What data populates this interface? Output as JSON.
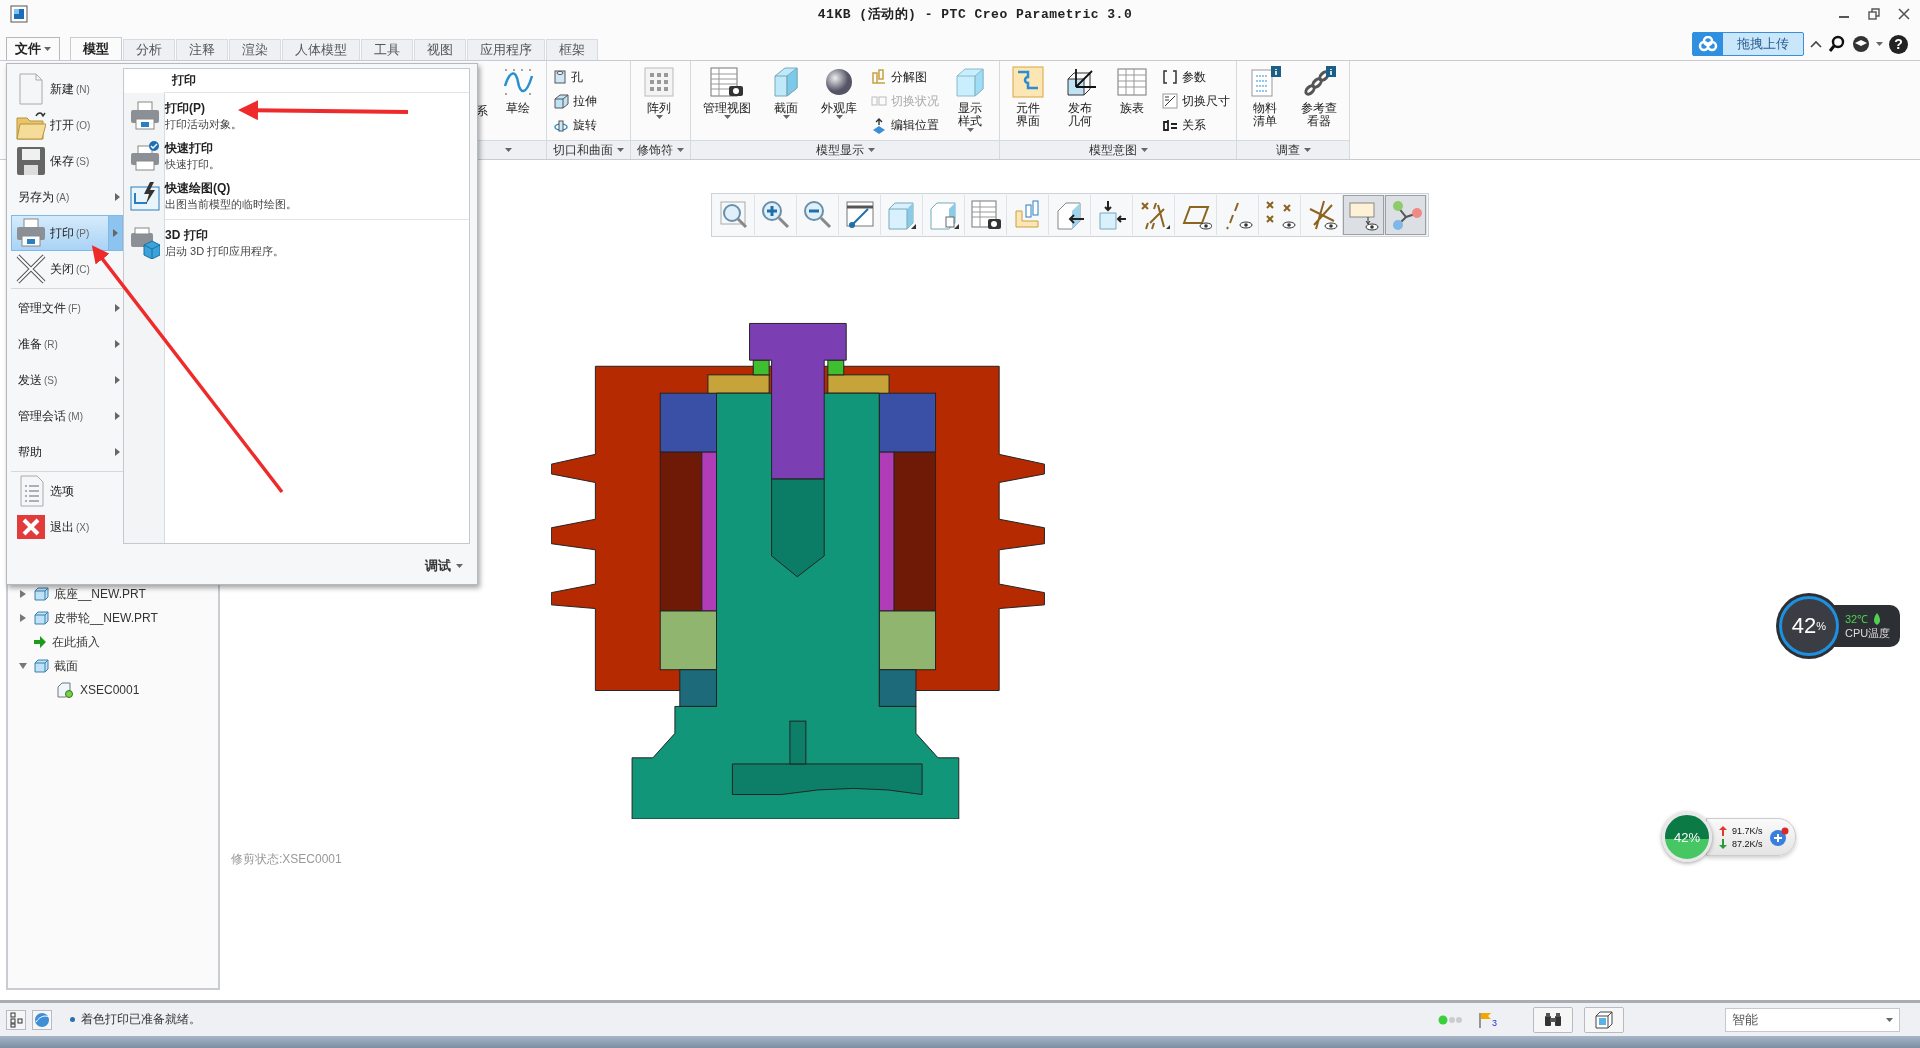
{
  "window": {
    "title": "41KB (活动的) - PTC Creo Parametric 3.0"
  },
  "upload_button": {
    "label": "拖拽上传"
  },
  "help_button": "?",
  "tabs": [
    {
      "label": "文件",
      "kind": "menu",
      "open": true
    },
    {
      "label": "模型",
      "kind": "tab",
      "selected": true
    },
    {
      "label": "分析",
      "kind": "tab",
      "selected": false
    },
    {
      "label": "注释",
      "kind": "tab",
      "selected": false
    },
    {
      "label": "渲染",
      "kind": "tab",
      "selected": false
    },
    {
      "label": "人体模型",
      "kind": "tab",
      "selected": false
    },
    {
      "label": "工具",
      "kind": "tab",
      "selected": false
    },
    {
      "label": "视图",
      "kind": "tab",
      "selected": false
    },
    {
      "label": "应用程序",
      "kind": "tab",
      "selected": false
    },
    {
      "label": "框架",
      "kind": "tab",
      "selected": false
    }
  ],
  "ribbon_groups": [
    {
      "items": [
        {
          "kind": "partial",
          "label": "系"
        },
        {
          "kind": "large",
          "label": "草绘",
          "disabled": false
        }
      ]
    },
    {
      "label": "切口和曲面",
      "items": [
        {
          "kind": "small",
          "label": "孔",
          "disabled": false
        },
        {
          "kind": "small",
          "label": "拉伸",
          "disabled": false
        },
        {
          "kind": "small",
          "label": "旋转",
          "disabled": false
        }
      ]
    },
    {
      "label": "修饰符",
      "items": [
        {
          "kind": "large",
          "label": "阵列",
          "dropdown": true,
          "disabled": false
        }
      ]
    },
    {
      "label": "模型显示",
      "items": [
        {
          "kind": "large",
          "label": "管理视图",
          "dropdown": true,
          "disabled": false
        },
        {
          "kind": "large",
          "label": "截面",
          "dropdown": true,
          "disabled": false
        },
        {
          "kind": "large",
          "label": "外观库",
          "dropdown": true,
          "disabled": false
        },
        {
          "kind": "small",
          "label": "分解图",
          "disabled": false
        },
        {
          "kind": "small",
          "label": "切换状况",
          "disabled": true
        },
        {
          "kind": "small",
          "label": "编辑位置",
          "disabled": false
        },
        {
          "kind": "tall",
          "label": "显示样式",
          "dropdown": true,
          "disabled": false
        }
      ]
    },
    {
      "label": "模型意图",
      "items": [
        {
          "kind": "tall",
          "label": "元件界面",
          "disabled": false
        },
        {
          "kind": "tall",
          "label": "发布几何",
          "disabled": false
        },
        {
          "kind": "large",
          "label": "族表",
          "disabled": false
        },
        {
          "kind": "small",
          "label": "参数",
          "disabled": false
        },
        {
          "kind": "small",
          "label": "切换尺寸",
          "disabled": false
        },
        {
          "kind": "small",
          "label": "关系",
          "disabled": false
        }
      ]
    },
    {
      "label": "调查",
      "items": [
        {
          "kind": "tall",
          "label": "物料清单",
          "disabled": false
        },
        {
          "kind": "tall",
          "label": "参考查看器",
          "disabled": false
        }
      ]
    }
  ],
  "file_menu": {
    "sections": [
      [
        {
          "kind": "new",
          "label": "新建",
          "key": "(N)",
          "submenu": false,
          "selected": false
        },
        {
          "kind": "open",
          "label": "打开",
          "key": "(O)",
          "submenu": false,
          "selected": false
        },
        {
          "kind": "save",
          "label": "保存",
          "key": "(S)",
          "submenu": false,
          "selected": false
        },
        {
          "kind": "saveas",
          "label": "另存为",
          "key": "(A)",
          "submenu": true,
          "selected": false
        },
        {
          "kind": "print",
          "label": "打印",
          "key": "(P)",
          "submenu": true,
          "selected": true
        },
        {
          "kind": "close",
          "label": "关闭",
          "key": "(C)",
          "submenu": false,
          "selected": false
        }
      ],
      [
        {
          "kind": "plain",
          "label": "管理文件",
          "key": "(F)",
          "submenu": true,
          "selected": false
        },
        {
          "kind": "plain",
          "label": "准备",
          "key": "(R)",
          "submenu": true,
          "selected": false
        },
        {
          "kind": "plain",
          "label": "发送",
          "key": "(S)",
          "submenu": true,
          "selected": false
        },
        {
          "kind": "plain",
          "label": "管理会话",
          "key": "(M)",
          "submenu": true,
          "selected": false
        },
        {
          "kind": "plain",
          "label": "帮助",
          "submenu": true,
          "selected": false
        }
      ],
      [
        {
          "kind": "options",
          "label": "选项",
          "submenu": false,
          "selected": false
        },
        {
          "kind": "exit",
          "label": "退出",
          "key": "(X)",
          "submenu": false,
          "selected": false
        }
      ]
    ],
    "panel": {
      "title": "打印",
      "groups": [
        [
          {
            "title": "打印(P)",
            "description": "打印活动对象。"
          },
          {
            "title": "快速打印",
            "description": "快速打印。"
          },
          {
            "title": "快速绘图(Q)",
            "description": "出图当前模型的临时绘图。"
          }
        ],
        [
          {
            "title": "3D 打印",
            "description": "启动 3D 打印应用程序。"
          }
        ]
      ]
    },
    "footer": "调试"
  },
  "model_tree": [
    {
      "kind": "part",
      "label": "底座__NEW.PRT",
      "expanded": false
    },
    {
      "kind": "part",
      "label": "皮带轮__NEW.PRT",
      "expanded": false
    },
    {
      "kind": "insert",
      "label": "在此插入"
    },
    {
      "kind": "folder",
      "label": "截面",
      "expanded": true,
      "children": [
        {
          "kind": "section",
          "label": "XSEC0001"
        }
      ]
    }
  ],
  "graphics_toolbar": [
    {
      "pressed": false
    },
    {
      "pressed": false
    },
    {
      "pressed": false
    },
    {
      "pressed": false
    },
    {
      "pressed": false
    },
    {
      "pressed": false
    },
    {
      "pressed": false
    },
    {
      "pressed": false
    },
    {
      "pressed": false
    },
    {
      "pressed": false
    },
    {
      "pressed": false
    },
    {
      "pressed": false
    },
    {
      "pressed": false
    },
    {
      "pressed": false
    },
    {
      "pressed": false
    },
    {
      "pressed": true
    },
    {
      "pressed": true
    }
  ],
  "graphics": {
    "clip_state": "修剪状态:XSEC0001"
  },
  "cpu_widget": {
    "usage": "42",
    "unit": "%",
    "temperature": "32℃",
    "label": "CPU温度"
  },
  "net_widget": {
    "usage": "42%",
    "upload": "91.7K/s",
    "download": "87.2K/s"
  },
  "status_bar": {
    "message": "着色打印已准备就绪。",
    "flag_count": "3",
    "filter": "智能"
  }
}
